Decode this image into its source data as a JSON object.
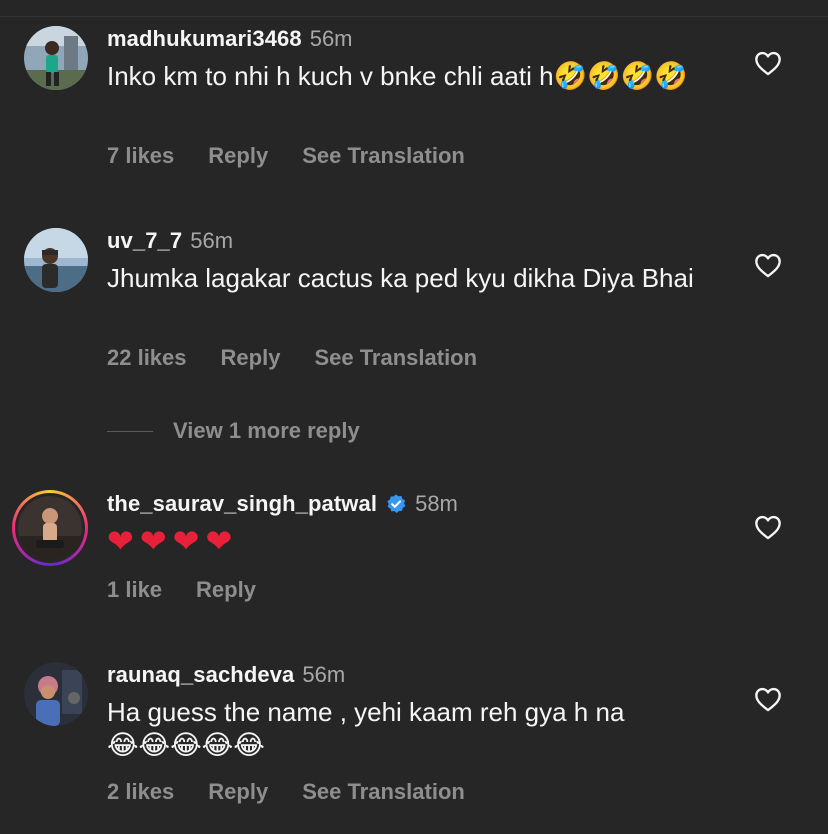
{
  "comments": [
    {
      "username": "madhukumari3468",
      "time": "56m",
      "text": "Inko km to nhi h kuch v bnke chli aati h",
      "text_emoji": "🤣🤣🤣🤣",
      "likes": "7 likes",
      "reply": "Reply",
      "translate": "See Translation"
    },
    {
      "username": "uv_7_7",
      "time": "56m",
      "text": "Jhumka lagakar cactus ka ped kyu dikha Diya Bhai",
      "likes": "22 likes",
      "reply": "Reply",
      "translate": "See Translation"
    },
    {
      "username": "the_saurav_singh_patwal",
      "time": "58m",
      "text_emoji": "❤❤❤❤",
      "likes": "1 like",
      "reply": "Reply"
    },
    {
      "username": "raunaq_sachdeva",
      "time": "56m",
      "text": "Ha guess the name , yehi kaam reh gya h na",
      "text_emoji": "😂😂😂😂😂",
      "likes": "2 likes",
      "reply": "Reply",
      "translate": "See Translation"
    }
  ],
  "view_more": "View 1 more reply",
  "icons": {
    "like": "heart-outline-icon",
    "verified": "verified-badge-icon"
  },
  "colors": {
    "background": "#262626",
    "muted": "#8e8e8e",
    "verified": "#3797f0"
  }
}
